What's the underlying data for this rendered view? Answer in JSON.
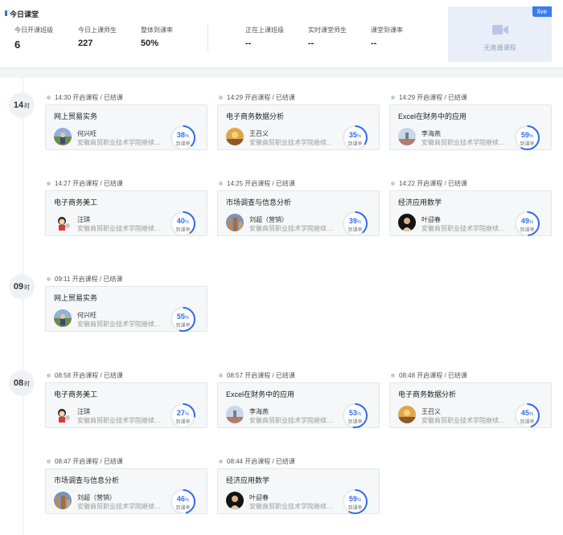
{
  "header": {
    "title": "今日课堂",
    "stats": [
      {
        "label": "今日开课班级",
        "value": "6"
      },
      {
        "label": "今日上课师生",
        "value": "227"
      },
      {
        "label": "整体到课率",
        "value": "50%"
      },
      {
        "label": "正在上课班级",
        "value": "--"
      },
      {
        "label": "实时课堂师生",
        "value": "--"
      },
      {
        "label": "课堂到课率",
        "value": "--"
      }
    ],
    "live": {
      "badge": "live",
      "text": "无直播课程",
      "icon": "video-camera-icon"
    }
  },
  "accent_color": "#2f6ee8",
  "rate_label": "到课率",
  "groups": [
    {
      "hour": "14",
      "unit": "时",
      "classes": [
        {
          "time": "14:30 开启课程 / 已结课",
          "course": "网上贸易实务",
          "teacher": "何兴旺",
          "school": "安徽商贸职业技术学院继续教育学院",
          "rate": 38,
          "avatar": "landscape"
        },
        {
          "time": "14:29 开启课程 / 已结课",
          "course": "电子商务数据分析",
          "teacher": "王召义",
          "school": "安徽商贸职业技术学院继续教育学院",
          "rate": 35,
          "avatar": "sunset"
        },
        {
          "time": "14:29 开启课程 / 已结课",
          "course": "Excel在财务中的应用",
          "teacher": "李海燕",
          "school": "安徽商贸职业技术学院继续教育学院",
          "rate": 59,
          "avatar": "sky"
        },
        {
          "time": "14:27 开启课程 / 已结课",
          "course": "电子商务美工",
          "teacher": "汪琪",
          "school": "安徽商贸职业技术学院继续教育学院",
          "rate": 40,
          "avatar": "cartoon"
        },
        {
          "time": "14:25 开启课程 / 已结课",
          "course": "市场调查与信息分析",
          "teacher": "刘超（营销）",
          "school": "安徽商贸职业技术学院继续教育学院",
          "rate": 39,
          "avatar": "city"
        },
        {
          "time": "14:22 开启课程 / 已结课",
          "course": "经济应用数学",
          "teacher": "叶迎春",
          "school": "安徽商贸职业技术学院继续教育学院",
          "rate": 49,
          "avatar": "dark"
        }
      ]
    },
    {
      "hour": "09",
      "unit": "时",
      "classes": [
        {
          "time": "09:11 开启课程 / 已结课",
          "course": "网上贸易实务",
          "teacher": "何兴旺",
          "school": "安徽商贸职业技术学院继续教育学院",
          "rate": 55,
          "avatar": "landscape"
        }
      ]
    },
    {
      "hour": "08",
      "unit": "时",
      "classes": [
        {
          "time": "08:58 开启课程 / 已结课",
          "course": "电子商务美工",
          "teacher": "汪琪",
          "school": "安徽商贸职业技术学院继续教育学院",
          "rate": 27,
          "avatar": "cartoon"
        },
        {
          "time": "08:57 开启课程 / 已结课",
          "course": "Excel在财务中的应用",
          "teacher": "李海燕",
          "school": "安徽商贸职业技术学院继续教育学院",
          "rate": 53,
          "avatar": "sky"
        },
        {
          "time": "08:48 开启课程 / 已结课",
          "course": "电子商务数据分析",
          "teacher": "王召义",
          "school": "安徽商贸职业技术学院继续教育学院",
          "rate": 45,
          "avatar": "sunset"
        },
        {
          "time": "08:47 开启课程 / 已结课",
          "course": "市场调查与信息分析",
          "teacher": "刘超（营销）",
          "school": "安徽商贸职业技术学院继续教育学院",
          "rate": 46,
          "avatar": "city"
        },
        {
          "time": "08:44 开启课程 / 已结课",
          "course": "经济应用数学",
          "teacher": "叶迎春",
          "school": "安徽商贸职业技术学院继续教育学院",
          "rate": 59,
          "avatar": "dark"
        }
      ]
    }
  ]
}
